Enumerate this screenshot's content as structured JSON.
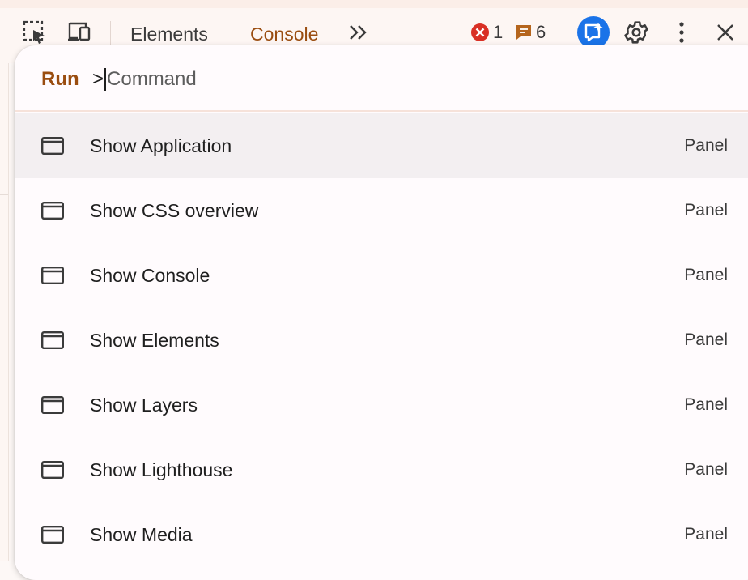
{
  "toolbar": {
    "tabs": [
      {
        "label": "Elements",
        "active": false
      },
      {
        "label": "Console",
        "active": true
      }
    ],
    "error_count": "1",
    "message_count": "6",
    "icons": [
      "inspect-element-icon",
      "device-toolbar-icon",
      "more-tabs-icon",
      "error-icon",
      "message-icon",
      "ai-assistant-icon",
      "settings-icon",
      "more-options-icon",
      "close-icon"
    ]
  },
  "palette": {
    "mode_label": "Run",
    "prompt_prefix": ">",
    "placeholder": "Command",
    "items": [
      {
        "label": "Show Application",
        "category": "Panel",
        "selected": true
      },
      {
        "label": "Show CSS overview",
        "category": "Panel",
        "selected": false
      },
      {
        "label": "Show Console",
        "category": "Panel",
        "selected": false
      },
      {
        "label": "Show Elements",
        "category": "Panel",
        "selected": false
      },
      {
        "label": "Show Layers",
        "category": "Panel",
        "selected": false
      },
      {
        "label": "Show Lighthouse",
        "category": "Panel",
        "selected": false
      },
      {
        "label": "Show Media",
        "category": "Panel",
        "selected": false
      }
    ]
  },
  "colors": {
    "accent": "#9a4d10",
    "error": "#d93025",
    "message": "#b5651d",
    "ai": "#1a73e8"
  }
}
